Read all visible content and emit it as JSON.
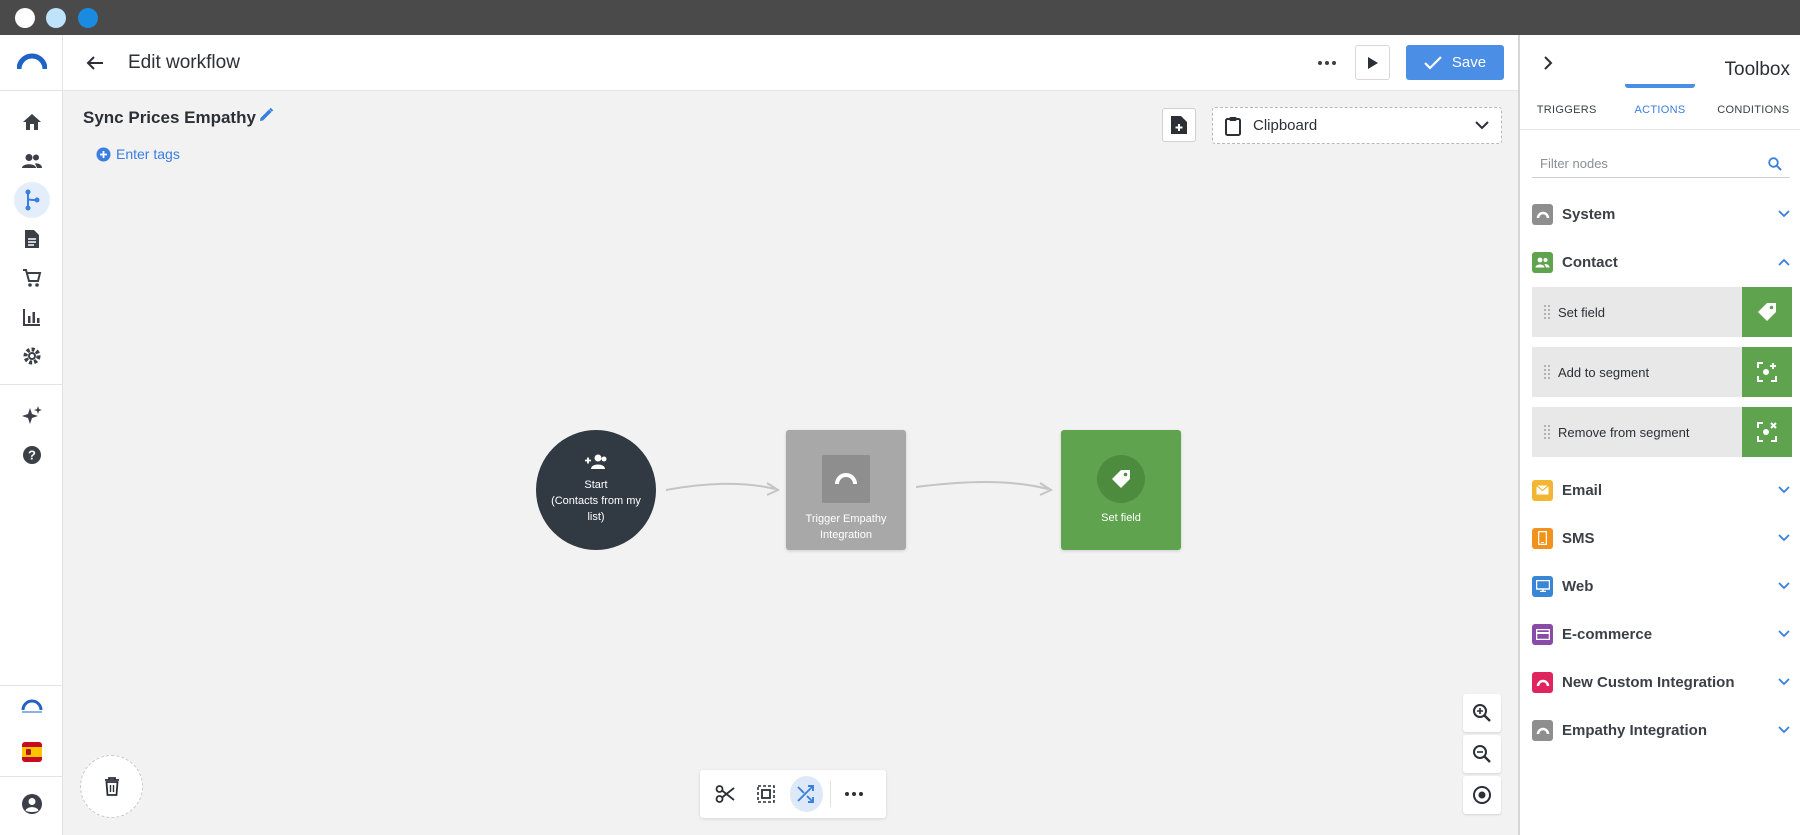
{
  "header": {
    "title": "Edit workflow",
    "save_label": "Save"
  },
  "workflow": {
    "name": "Sync Prices Empathy",
    "tags_placeholder": "Enter tags"
  },
  "clipboard": {
    "label": "Clipboard"
  },
  "nodes": {
    "start": {
      "title": "Start",
      "subtitle": "(Contacts from my list)"
    },
    "trigger": {
      "label": "Trigger Empathy Integration"
    },
    "set_field": {
      "label": "Set field"
    }
  },
  "toolbox": {
    "title": "Toolbox",
    "tabs": [
      {
        "label": "TRIGGERS",
        "active": false
      },
      {
        "label": "ACTIONS",
        "active": true
      },
      {
        "label": "CONDITIONS",
        "active": false
      }
    ],
    "filter_placeholder": "Filter nodes",
    "categories": [
      {
        "label": "System",
        "color": "#8e8e8e",
        "expanded": false
      },
      {
        "label": "Contact",
        "color": "#5fa34f",
        "expanded": true
      },
      {
        "label": "Email",
        "color": "#f2b632",
        "expanded": false
      },
      {
        "label": "SMS",
        "color": "#f0921c",
        "expanded": false
      },
      {
        "label": "Web",
        "color": "#3a86d6",
        "expanded": false
      },
      {
        "label": "E-commerce",
        "color": "#8a4aa8",
        "expanded": false
      },
      {
        "label": "New Custom Integration",
        "color": "#e0245e",
        "expanded": false
      },
      {
        "label": "Empathy Integration",
        "color": "#8e8e8e",
        "expanded": false
      }
    ],
    "contact_actions": [
      {
        "label": "Set field",
        "icon": "tag-icon"
      },
      {
        "label": "Add to segment",
        "icon": "segment-add-icon"
      },
      {
        "label": "Remove from segment",
        "icon": "segment-remove-icon"
      }
    ]
  },
  "colors": {
    "accent": "#4a8ee6",
    "dark_node": "#313942",
    "green_node": "#5fa34f",
    "grey_node": "#a8a8a8"
  }
}
